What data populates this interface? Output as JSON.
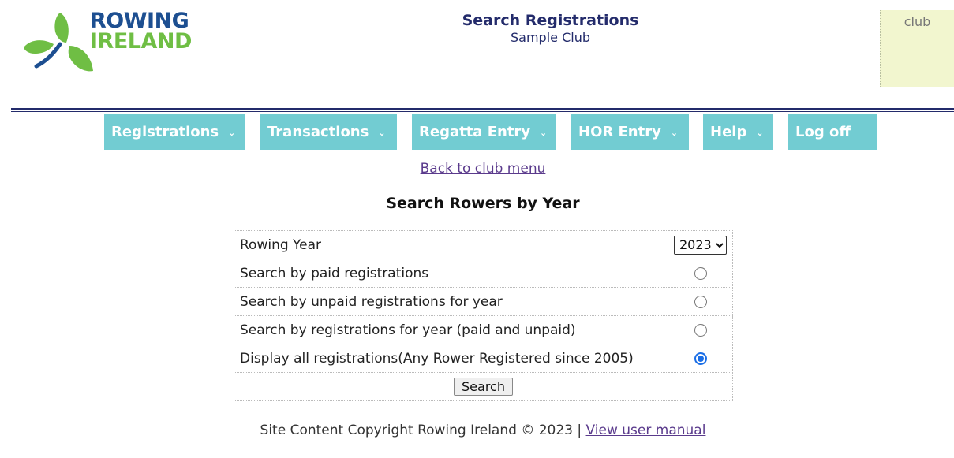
{
  "logo": {
    "line1": "ROWING",
    "line2": "IRELAND",
    "colors": {
      "blue": "#1d4f91",
      "green": "#6fbe44"
    }
  },
  "header": {
    "title": "Search Registrations",
    "subtitle": "Sample Club",
    "club_label": "club"
  },
  "nav": {
    "items": [
      {
        "label": "Registrations",
        "chevron": "⌄"
      },
      {
        "label": "Transactions",
        "chevron": "⌄"
      },
      {
        "label": "Regatta Entry",
        "chevron": "⌄"
      },
      {
        "label": "HOR Entry",
        "chevron": "⌄"
      },
      {
        "label": "Help",
        "chevron": "⌄"
      },
      {
        "label": "Log off"
      }
    ],
    "accent": "#72ccd2"
  },
  "back_link": "Back to club menu",
  "section_title": "Search Rowers by Year",
  "form": {
    "year_label": "Rowing Year",
    "year_options": [
      "2023"
    ],
    "year_selected": "2023",
    "options": [
      {
        "label": "Search by paid registrations",
        "checked": false
      },
      {
        "label": "Search by unpaid registrations for year",
        "checked": false
      },
      {
        "label": "Search by registrations for year (paid and unpaid)",
        "checked": false
      },
      {
        "label": "Display all registrations(Any Rower Registered since 2005)",
        "checked": true
      }
    ],
    "search_button": "Search"
  },
  "footer": {
    "text": "Site Content Copyright Rowing Ireland © 2023 |",
    "link": "View user manual"
  }
}
